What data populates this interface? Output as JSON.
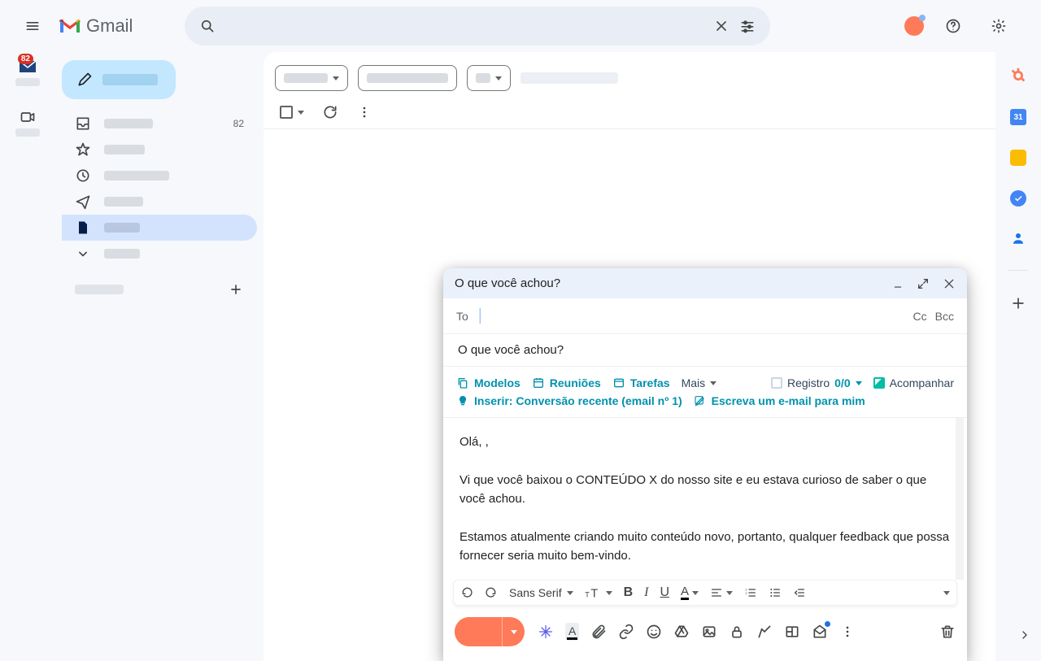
{
  "app": {
    "name": "Gmail"
  },
  "header": {
    "mail_badge": "82"
  },
  "sidebar": {
    "inbox_count": "82",
    "items": [
      {
        "id": "inbox"
      },
      {
        "id": "starred"
      },
      {
        "id": "snoozed"
      },
      {
        "id": "sent"
      },
      {
        "id": "drafts"
      },
      {
        "id": "more"
      }
    ]
  },
  "compose": {
    "title": "O que você achou?",
    "to_label": "To",
    "cc": "Cc",
    "bcc": "Bcc",
    "subject": "O que você achou?",
    "hubspot": {
      "modelos": "Modelos",
      "reunioes": "Reuniões",
      "tarefas": "Tarefas",
      "mais": "Mais",
      "registro": "Registro",
      "registro_count": "0/0",
      "acompanhar": "Acompanhar",
      "inserir": "Inserir: Conversão recente (email nº 1)",
      "escreva": "Escreva um e-mail para mim"
    },
    "body": {
      "greeting": "Olá, ,",
      "p1": "Vi que você baixou o CONTEÚDO X do nosso site e eu estava curioso de saber o que você achou.",
      "p2": "Estamos atualmente criando muito conteúdo novo, portanto, qualquer feedback que possa fornecer seria muito bem-vindo."
    },
    "format": {
      "font": "Sans Serif"
    }
  },
  "rightRail": {
    "calendar_day": "31"
  }
}
